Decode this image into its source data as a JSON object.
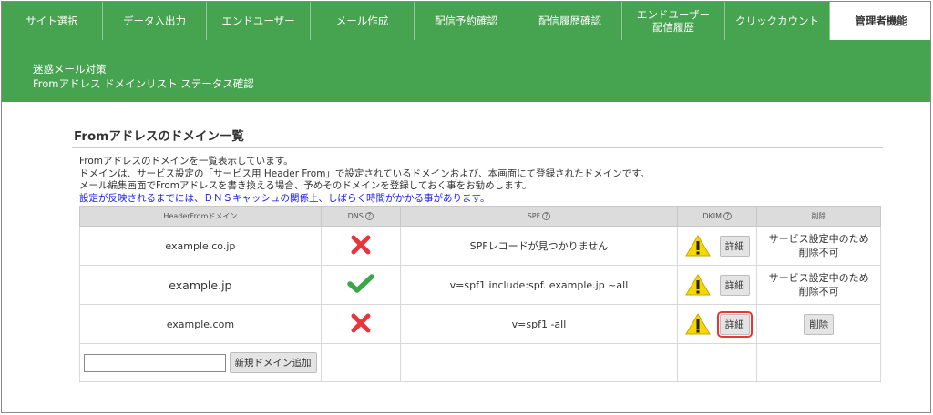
{
  "nav": {
    "tabs": [
      {
        "label": "サイト選択",
        "active": false
      },
      {
        "label": "データ入出力",
        "active": false
      },
      {
        "label": "エンドユーザー",
        "active": false
      },
      {
        "label": "メール作成",
        "active": false
      },
      {
        "label": "配信予約確認",
        "active": false
      },
      {
        "label": "配信履歴確認",
        "active": false
      },
      {
        "label": "エンドユーザー\n配信履歴",
        "active": false
      },
      {
        "label": "クリックカウント",
        "active": false
      },
      {
        "label": "管理者機能",
        "active": true
      }
    ]
  },
  "banner": {
    "line1": "迷惑メール対策",
    "line2": "Fromアドレス ドメインリスト ステータス確認"
  },
  "section": {
    "title": "Fromアドレスのドメイン一覧",
    "desc1": "Fromアドレスのドメインを一覧表示しています。",
    "desc2": "ドメインは、サービス設定の「サービス用 Header From」で設定されているドメインおよび、本画面にて登録されたドメインです。",
    "desc3": "メール編集画面でFromアドレスを書き換える場合、予めそのドメインを登録しておく事をお勧めします。",
    "desc4": "設定が反映されるまでには、ＤＮＳキャッシュの関係上、しばらく時間がかかる事があります。"
  },
  "table": {
    "headers": {
      "domain": "HeaderFromドメイン",
      "dns": "DNS",
      "spf": "SPF",
      "dkim": "DKIM",
      "delete": "削除"
    },
    "help_glyph": "?",
    "rows": [
      {
        "domain": "example.co.jp",
        "dns": "fail",
        "spf": "SPFレコードが見つかりません",
        "detail": "詳細",
        "delete_note1": "サービス設定中のため",
        "delete_note2": "削除不可"
      },
      {
        "domain": "example.jp",
        "dns": "ok",
        "spf": "v=spf1 include:spf. example.jp ~all",
        "detail": "詳細",
        "delete_note1": "サービス設定中のため",
        "delete_note2": "削除不可"
      },
      {
        "domain": "example.com",
        "dns": "fail",
        "spf": "v=spf1 -all",
        "detail": "詳細",
        "delete_button": "削除"
      }
    ],
    "add_button": "新規ドメイン追加",
    "add_input_value": ""
  },
  "colors": {
    "brand_green": "#46a34f",
    "fail_red": "#e8343a",
    "ok_green": "#3aa84a",
    "warn_yellow": "#f5d800",
    "highlight": "#e33333"
  }
}
